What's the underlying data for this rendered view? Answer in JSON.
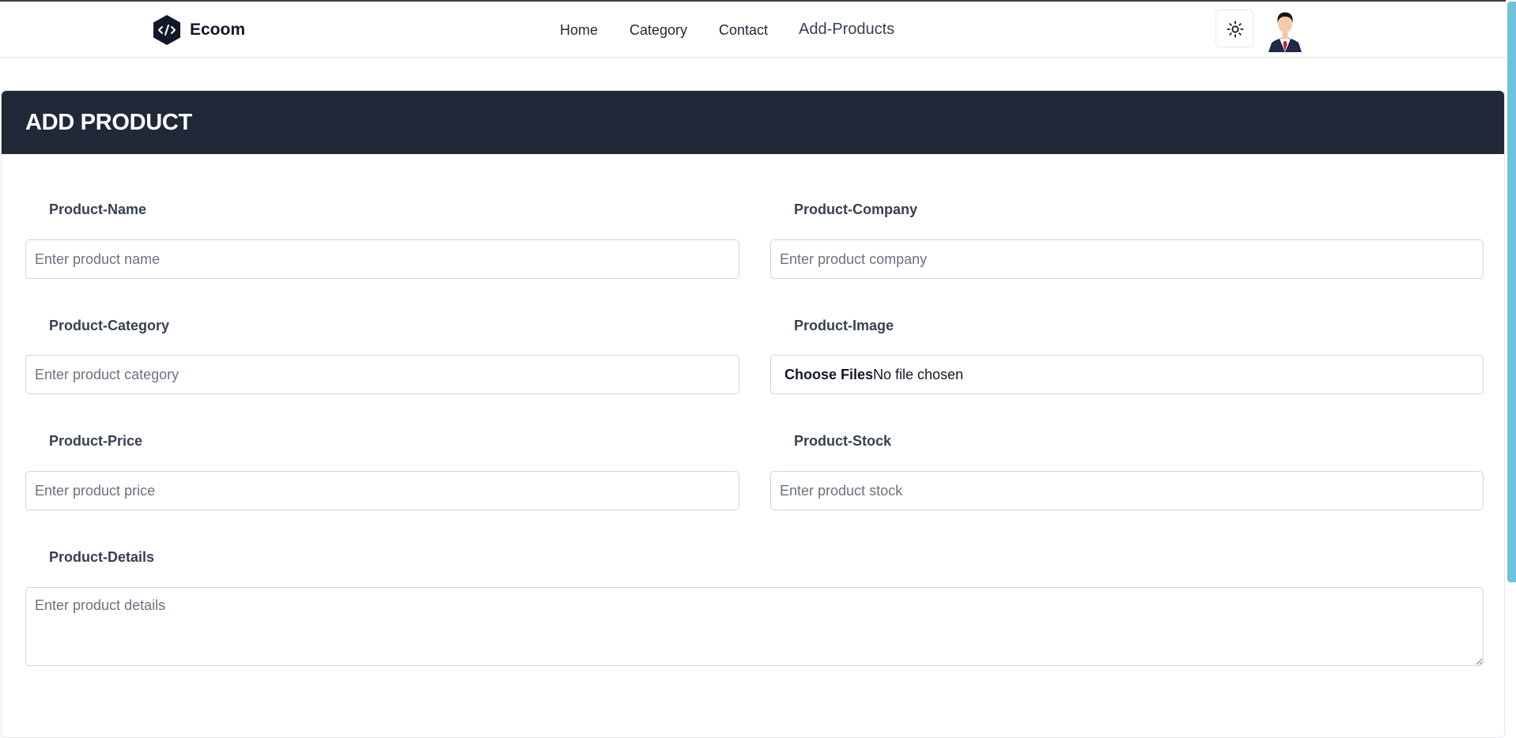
{
  "brand": {
    "name": "Ecoom",
    "icon": "code-icon"
  },
  "nav": {
    "items": [
      {
        "label": "Home"
      },
      {
        "label": "Category"
      },
      {
        "label": "Contact"
      },
      {
        "label": "Add-Products"
      }
    ],
    "theme_icon": "sun-icon",
    "avatar_icon": "user-avatar"
  },
  "page": {
    "title": "ADD PRODUCT"
  },
  "form": {
    "name": {
      "label": "Product-Name",
      "placeholder": "Enter product name",
      "value": ""
    },
    "company": {
      "label": "Product-Company",
      "placeholder": "Enter product company",
      "value": ""
    },
    "category": {
      "label": "Product-Category",
      "placeholder": "Enter product category",
      "value": ""
    },
    "image": {
      "label": "Product-Image",
      "button": "Choose Files",
      "status": "No file chosen"
    },
    "price": {
      "label": "Product-Price",
      "placeholder": "Enter product price",
      "value": ""
    },
    "stock": {
      "label": "Product-Stock",
      "placeholder": "Enter product stock",
      "value": ""
    },
    "details": {
      "label": "Product-Details",
      "placeholder": "Enter product details",
      "value": ""
    }
  },
  "colors": {
    "header_bg": "#1f2937",
    "scrollbar": "#6cc3dc"
  }
}
